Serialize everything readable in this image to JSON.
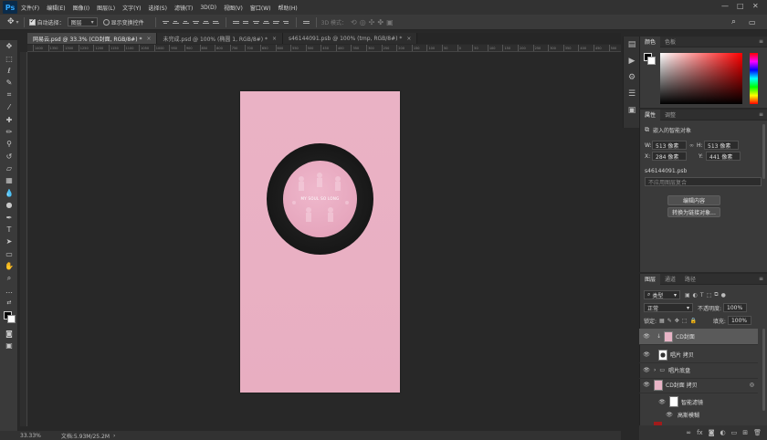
{
  "app": {
    "logo": "Ps"
  },
  "menu": [
    "文件(F)",
    "编辑(E)",
    "图像(I)",
    "图层(L)",
    "文字(Y)",
    "选择(S)",
    "滤镜(T)",
    "3D(D)",
    "视图(V)",
    "窗口(W)",
    "帮助(H)"
  ],
  "window_controls": {
    "min": "—",
    "max": "□",
    "close": "✕"
  },
  "options": {
    "auto_select_label": "自动选择：",
    "auto_select_value": "图层",
    "show_transform_label": "显示变换控件",
    "mode_3d": "3D 模式："
  },
  "doc_tabs": [
    {
      "label": "网易云.psd @ 33.3% (CD封面, RGB/8#) *",
      "active": true
    },
    {
      "label": "未完成.psd @ 100% (椭圆 1, RGB/8#) *",
      "active": false
    },
    {
      "label": "s46144091.psb @ 100% (tmp, RGB/8#) *",
      "active": false
    }
  ],
  "ruler_ticks": [
    "1400",
    "1350",
    "1300",
    "1250",
    "1200",
    "1150",
    "1100",
    "1050",
    "1000",
    "950",
    "900",
    "850",
    "800",
    "750",
    "700",
    "650",
    "600",
    "550",
    "500",
    "450",
    "400",
    "350",
    "300",
    "250",
    "200",
    "150",
    "100",
    "50",
    "0",
    "50",
    "100",
    "150",
    "200",
    "250",
    "300",
    "350",
    "400",
    "450",
    "500",
    "550",
    "600",
    "650",
    "700",
    "750",
    "800",
    "850",
    "900",
    "950",
    "1000",
    "1050",
    "1100",
    "1150",
    "1200",
    "1250",
    "1300",
    "1350",
    "1400",
    "1450",
    "1500",
    "1550",
    "1600",
    "1650",
    "1700",
    "1750",
    "1800",
    "1850",
    "1900",
    "1950",
    "2000",
    "2050",
    "2100",
    "2150",
    "2200",
    "2250",
    "2300",
    "2350",
    "2400",
    "2450"
  ],
  "canvas": {
    "label_text": "MY SOUL SO LONG",
    "artboard_color": "#eab2c5"
  },
  "status": {
    "zoom": "33.33%",
    "doc": "文档:5.93M/25.2M"
  },
  "color_panel": {
    "tabs": [
      "颜色",
      "色板"
    ]
  },
  "properties": {
    "tabs": [
      "属性",
      "调整"
    ],
    "subtitle": "嵌入的智能对象",
    "w_label": "W:",
    "w_value": "513 像素",
    "h_label": "H:",
    "h_value": "513 像素",
    "x_label": "X:",
    "x_value": "284 像素",
    "y_label": "Y:",
    "y_value": "441 像素",
    "file": "s46144091.psb",
    "comp_placeholder": "不应用图层复合",
    "edit_btn": "编辑内容",
    "convert_btn": "转换为链接对象..."
  },
  "layers_panel": {
    "tabs": [
      "图层",
      "通道",
      "路径"
    ],
    "filter_kind": "类型",
    "blend_mode": "正常",
    "opacity_label": "不透明度:",
    "opacity_value": "100%",
    "lock_label": "锁定:",
    "fill_label": "填充:",
    "fill_value": "100%",
    "layers": [
      {
        "name": "CD封面",
        "selected": true
      },
      {
        "name": "唱片 拷贝",
        "selected": false
      },
      {
        "name": "唱片底盘",
        "selected": false
      },
      {
        "name": "CD封面 拷贝",
        "selected": false
      },
      {
        "name": "智能滤镜",
        "selected": false
      },
      {
        "name": "高斯模糊",
        "selected": false
      }
    ]
  }
}
